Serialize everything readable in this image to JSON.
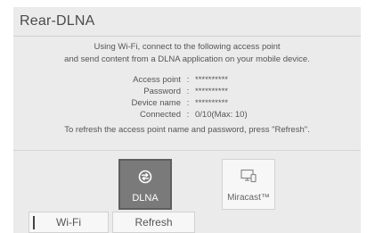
{
  "header": {
    "title": "Rear-DLNA"
  },
  "instructions": {
    "line1": "Using Wi-Fi, connect to the following access point",
    "line2": "and send content from a DLNA application on your mobile device."
  },
  "connection_info": {
    "separator": ":",
    "rows": [
      {
        "label": "Access point",
        "value": "**********"
      },
      {
        "label": "Password",
        "value": "**********"
      },
      {
        "label": "Device name",
        "value": "**********"
      },
      {
        "label": "Connected",
        "value": "0/10(Max: 10)"
      }
    ]
  },
  "refresh_note": "To refresh the access point name and password, press \"Refresh\".",
  "sources": [
    {
      "label": "DLNA",
      "icon": "dlna-icon",
      "selected": true
    },
    {
      "label": "Miracast™",
      "icon": "miracast-icon",
      "selected": false
    }
  ],
  "tabs": [
    {
      "label": "Wi-Fi",
      "active": true
    },
    {
      "label": "Refresh",
      "active": false
    }
  ],
  "colors": {
    "selected_tile": "#7a7a7a",
    "background": "#ebebeb",
    "text": "#555555"
  }
}
